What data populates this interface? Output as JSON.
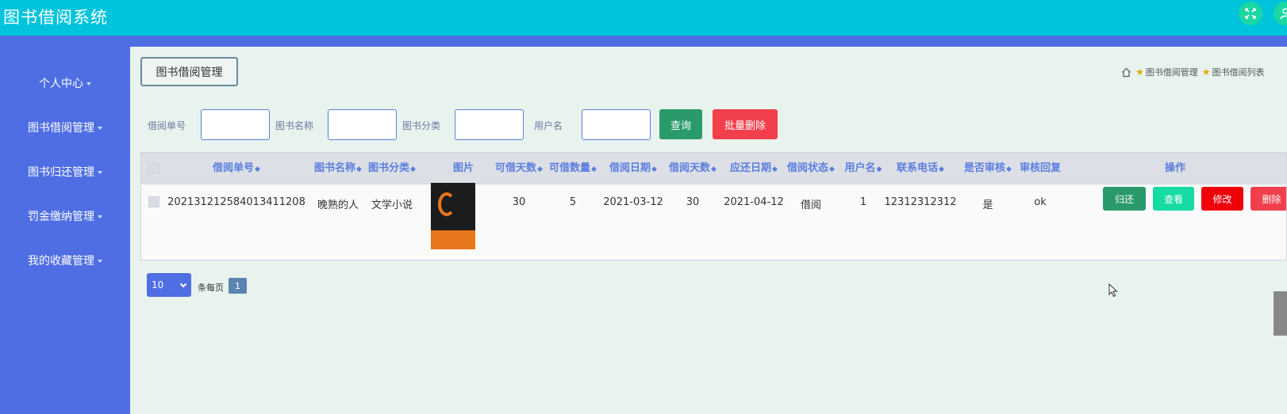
{
  "app": {
    "title": "图书借阅系统"
  },
  "topbar": {
    "icons": [
      "expand-icon",
      "user-icon"
    ],
    "color": "#00c3dc"
  },
  "sidebar": {
    "color": "#4f6ee3",
    "items": [
      {
        "label": "个人中心"
      },
      {
        "label": "图书借阅管理"
      },
      {
        "label": "图书归还管理"
      },
      {
        "label": "罚金缴纳管理"
      },
      {
        "label": "我的收藏管理"
      }
    ]
  },
  "main": {
    "tab_label": "图书借阅管理"
  },
  "breadcrumb": {
    "items": [
      "图书借阅管理",
      "图书借阅列表"
    ]
  },
  "search": {
    "fields": [
      {
        "label": "借阅单号",
        "value": ""
      },
      {
        "label": "图书名称",
        "value": ""
      },
      {
        "label": "图书分类",
        "value": ""
      },
      {
        "label": "用户名",
        "value": ""
      }
    ],
    "query_label": "查询",
    "batch_delete_label": "批量删除"
  },
  "table": {
    "columns": [
      "借阅单号",
      "图书名称",
      "图书分类",
      "图片",
      "可借天数",
      "可借数量",
      "借阅日期",
      "借阅天数",
      "应还日期",
      "借阅状态",
      "用户名",
      "联系电话",
      "是否审核",
      "审核回复",
      "操作"
    ],
    "rows": [
      {
        "borrow_no": "20213121258401341120​8",
        "book_name": "晚熟的人",
        "category": "文学小说",
        "image": "book-cover",
        "borrow_days_allowed": "30",
        "available_qty": "5",
        "borrow_date": "2021-03-12",
        "borrow_days": "30",
        "due_date": "2021-04-12",
        "status": "借阅",
        "username": "1",
        "phone": "12312312312",
        "reviewed": "是",
        "review_reply": "ok"
      }
    ],
    "actions": {
      "return": "归还",
      "view": "查看",
      "edit": "修改",
      "delete": "删除"
    }
  },
  "pagination": {
    "page_size": "10",
    "per_page_label": "条每页",
    "current_page": "1"
  },
  "colors": {
    "accent": "#4f6ee3",
    "teal": "#00c3dc",
    "green": "#2a9a6b",
    "red": "#f23f4c",
    "bright_red": "#f0000b",
    "mint": "#16dba2"
  }
}
